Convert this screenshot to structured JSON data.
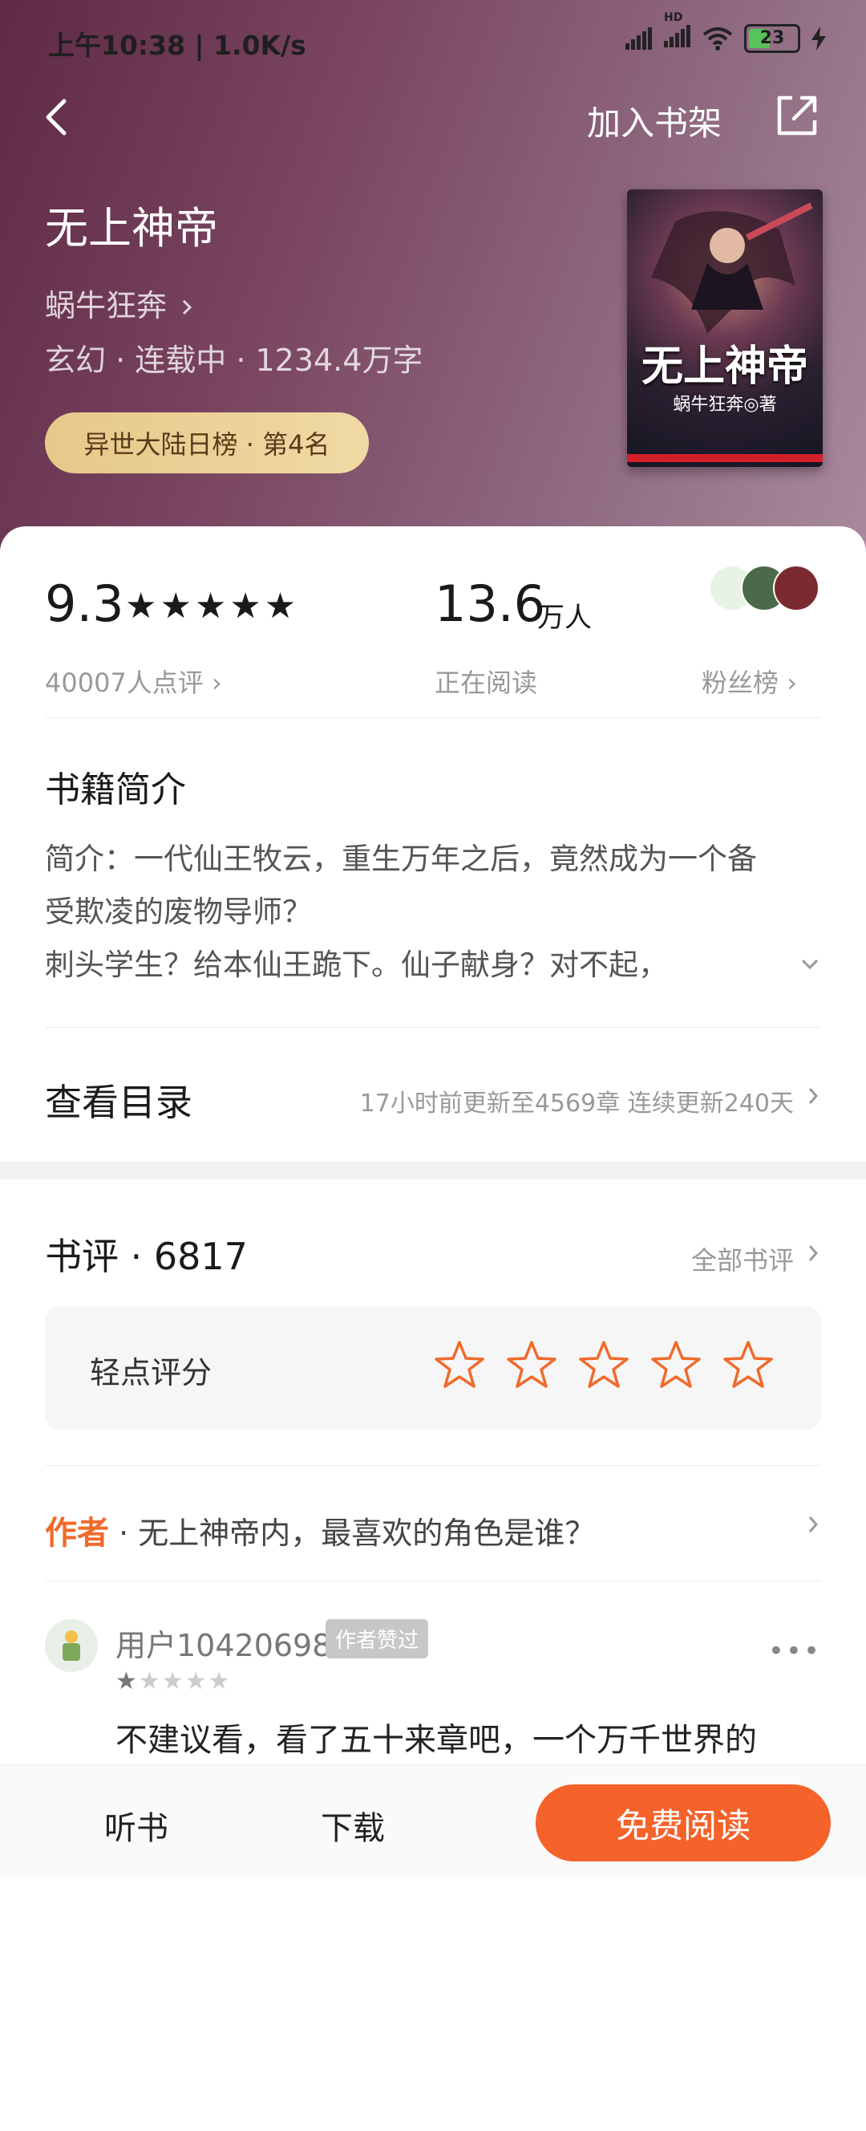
{
  "status_bar": {
    "time_speed": "上午10:38 | 1.0K/s",
    "network_label": "HD",
    "battery": "23"
  },
  "header": {
    "add_to_shelf": "加入书架"
  },
  "book": {
    "title": "无上神帝",
    "author": "蜗牛狂奔",
    "meta": "玄幻 · 连载中 · 1234.4万字",
    "rank_badge": "异世大陆日榜 · 第4名",
    "cover_title": "无上神帝",
    "cover_author": "蜗牛狂奔◎著"
  },
  "stats": {
    "score": "9.3",
    "stars": "★★★★★",
    "rating_count": "40007人点评",
    "readers": "13.6",
    "readers_unit": "万人",
    "readers_label": "正在阅读",
    "fans_label": "粉丝榜"
  },
  "intro": {
    "heading": "书籍简介",
    "lines": [
      "简介：一代仙王牧云，重生万年之后，竟然成为一个备",
      "受欺凌的废物导师？",
      "刺头学生？给本仙王跪下。仙子献身？对不起，"
    ]
  },
  "catalog": {
    "label": "查看目录",
    "info": "17小时前更新至4569章 连续更新240天"
  },
  "reviews": {
    "title": "书评 · 6817",
    "all_label": "全部书评",
    "rate_label": "轻点评分",
    "question_tag": "作者",
    "question_text": " · 无上神帝内，最喜欢的角色是谁？",
    "items": [
      {
        "user": "用户10420698",
        "badge": "作者赞过",
        "stars_on": "★",
        "stars_off": "★★★★",
        "rating": 1,
        "text": "不建议看，看了五十来章吧，一个万千世界的"
      }
    ]
  },
  "bottom_bar": {
    "listen": "听书",
    "download": "下载",
    "read": "免费阅读"
  },
  "colors": {
    "accent": "#f5622a",
    "hero_start": "#5e2a45",
    "hero_end": "#a88a9c",
    "badge_gold": "#e6c98a"
  }
}
